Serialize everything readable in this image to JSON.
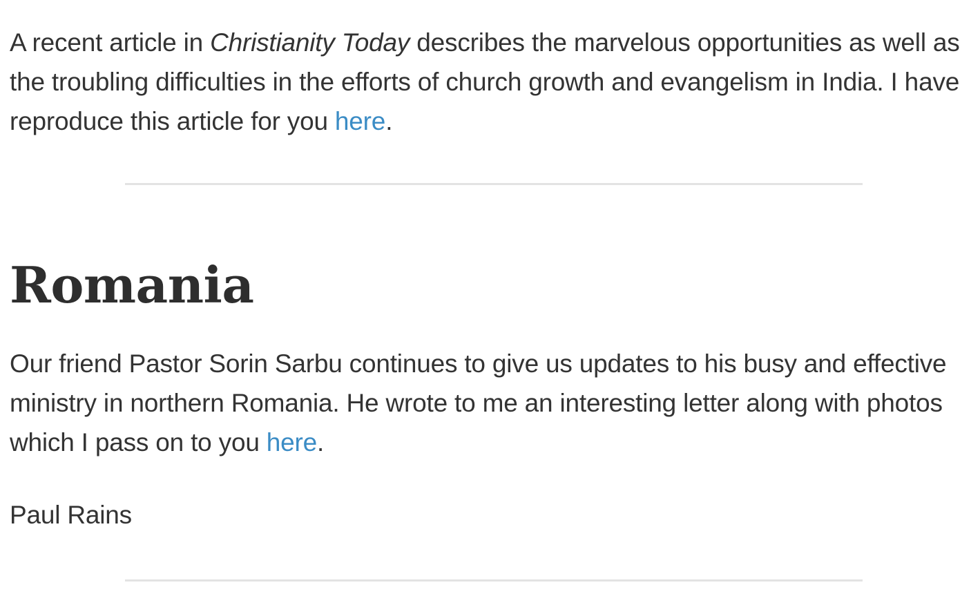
{
  "india": {
    "text_before_italic": "A recent article in ",
    "italic_publication": "Christianity Today",
    "text_after_italic": " describes the marvelous opportunities as well as the troubling difficulties in the efforts of church growth and evangelism in India. I have reproduce this article for you ",
    "link_label": "here",
    "end_punctuation": "."
  },
  "romania": {
    "heading": "Romania",
    "text_before_link": "Our friend Pastor Sorin Sarbu continues to give us updates to his busy and effective ministry in northern Romania. He wrote to me an interesting letter along with photos which I pass on to you ",
    "link_label": "here",
    "end_punctuation": "."
  },
  "signature": "Paul Rains",
  "colors": {
    "text": "#333333",
    "link": "#3b8cc5",
    "divider": "#e3e3e3"
  }
}
